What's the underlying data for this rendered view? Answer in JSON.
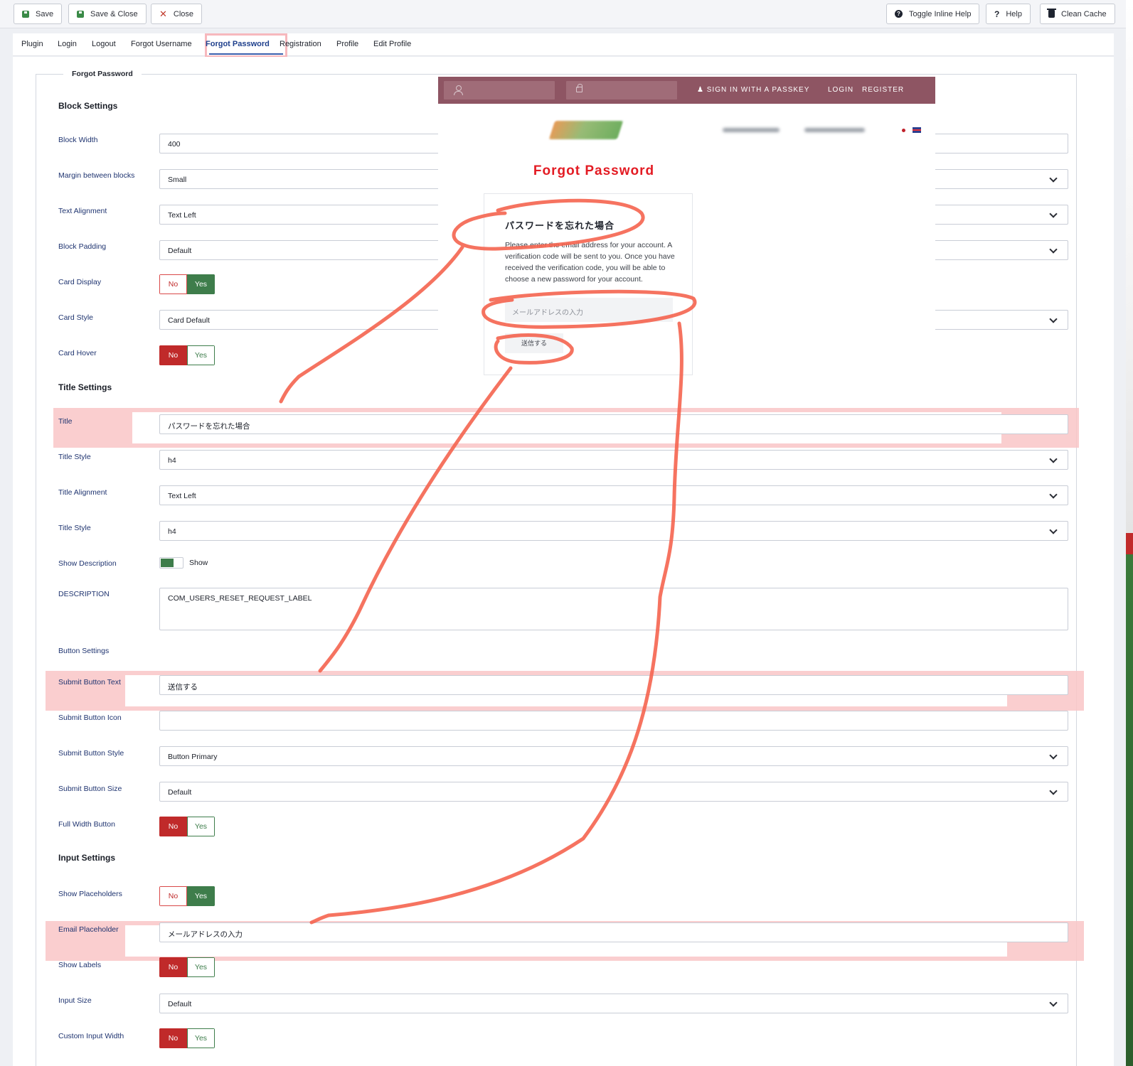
{
  "toolbar": {
    "save": "Save",
    "save_close": "Save & Close",
    "close": "Close",
    "toggle_help": "Toggle Inline Help",
    "help": "Help",
    "clean_cache": "Clean Cache"
  },
  "tabs": [
    "Plugin",
    "Login",
    "Logout",
    "Forgot Username",
    "Forgot Password",
    "Registration",
    "Profile",
    "Edit Profile"
  ],
  "active_tab": "Forgot Password",
  "fieldset_legend": "Forgot Password",
  "block_settings": {
    "title": "Block Settings",
    "block_width": {
      "label": "Block Width",
      "value": "400"
    },
    "margin": {
      "label": "Margin between blocks",
      "value": "Small"
    },
    "text_alignment": {
      "label": "Text Alignment",
      "value": "Text Left"
    },
    "block_padding": {
      "label": "Block Padding",
      "value": "Default"
    },
    "card_display": {
      "label": "Card Display",
      "selected": "Yes"
    },
    "card_style": {
      "label": "Card Style",
      "value": "Card Default"
    },
    "card_hover": {
      "label": "Card Hover",
      "selected": "No"
    }
  },
  "title_settings": {
    "title": "Title Settings",
    "title_field": {
      "label": "Title",
      "value": "パスワードを忘れた場合"
    },
    "title_style": {
      "label": "Title Style",
      "value": "h4"
    },
    "title_alignment": {
      "label": "Title Alignment",
      "value": "Text Left"
    },
    "title_style_2": {
      "label": "Title Style",
      "value": "h4"
    },
    "show_description": {
      "label": "Show Description",
      "toggle_text": "Show",
      "on": true
    },
    "description": {
      "label": "DESCRIPTION",
      "value": "COM_USERS_RESET_REQUEST_LABEL"
    }
  },
  "button_settings": {
    "title": "Button Settings",
    "submit_text": {
      "label": "Submit Button Text",
      "value": "送信する"
    },
    "submit_icon": {
      "label": "Submit Button Icon",
      "value": ""
    },
    "submit_style": {
      "label": "Submit Button Style",
      "value": "Button Primary"
    },
    "submit_size": {
      "label": "Submit Button Size",
      "value": "Default"
    },
    "full_width": {
      "label": "Full Width Button",
      "selected": "No"
    }
  },
  "input_settings": {
    "title": "Input Settings",
    "show_placeholders": {
      "label": "Show Placeholders",
      "selected": "Yes"
    },
    "email_placeholder": {
      "label": "Email Placeholder",
      "value": "メールアドレスの入力"
    },
    "show_labels": {
      "label": "Show Labels",
      "selected": "No"
    },
    "input_size": {
      "label": "Input Size",
      "value": "Default"
    },
    "custom_input_width": {
      "label": "Custom Input Width",
      "selected": "No"
    }
  },
  "segment_labels": {
    "no": "No",
    "yes": "Yes"
  },
  "preview": {
    "nav_passkey": "SIGN IN WITH A PASSKEY",
    "nav_login": "LOGIN",
    "nav_register": "REGISTER",
    "page_title": "Forgot Password",
    "card_title": "パスワードを忘れた場合",
    "description": "Please enter the email address for your account. A verification code will be sent to you. Once you have received the verification code, you will be able to choose a new password for your account.",
    "email_placeholder": "メールアドレスの入力",
    "submit": "送信する"
  },
  "colors": {
    "annotation_stroke": "#f5644f",
    "highlight": "#f9c5c7",
    "preview_header": "#8e5563",
    "preview_title": "#e31b23"
  }
}
